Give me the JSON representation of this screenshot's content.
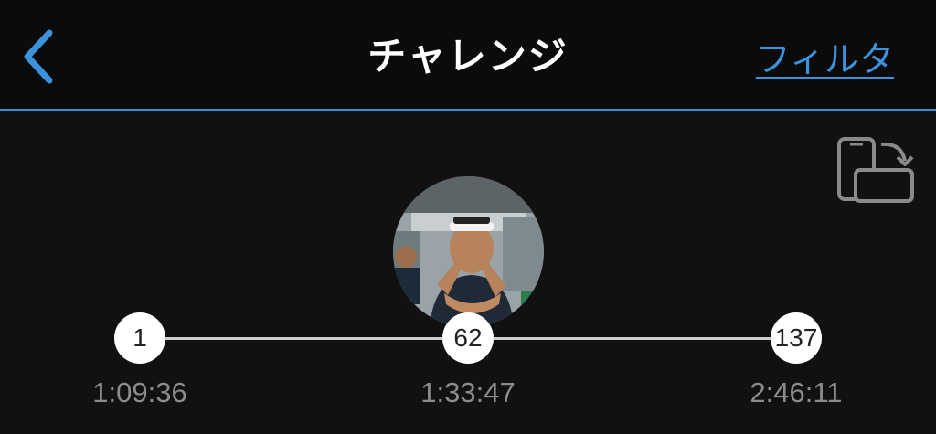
{
  "header": {
    "title": "チャレンジ",
    "filter_label": "フィルタ",
    "back_icon": "chevron-left-icon"
  },
  "colors": {
    "accent": "#3b93de",
    "background": "#111111",
    "node": "#ffffff",
    "time_text": "#8c8c8c"
  },
  "rotate_icon": "rotate-device-icon",
  "timeline": {
    "points": [
      {
        "rank": "1",
        "time": "1:09:36"
      },
      {
        "rank": "62",
        "time": "1:33:47"
      },
      {
        "rank": "137",
        "time": "2:46:11"
      }
    ]
  }
}
